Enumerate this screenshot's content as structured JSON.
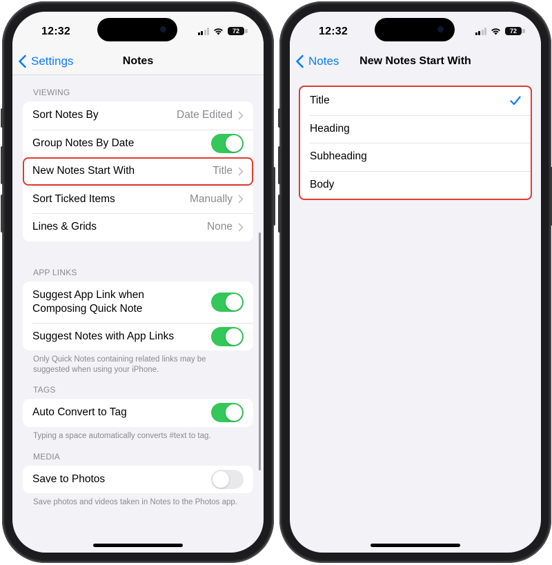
{
  "status_bar": {
    "time": "12:32",
    "battery": "72"
  },
  "left_screen": {
    "nav": {
      "back_label": "Settings",
      "title": "Notes"
    },
    "sections": [
      {
        "header": "VIEWING",
        "rows": [
          {
            "label": "Sort Notes By",
            "value": "Date Edited",
            "type": "disclosure"
          },
          {
            "label": "Group Notes By Date",
            "type": "toggle",
            "on": true
          },
          {
            "label": "New Notes Start With",
            "value": "Title",
            "type": "disclosure",
            "highlighted": true
          },
          {
            "label": "Sort Ticked Items",
            "value": "Manually",
            "type": "disclosure"
          },
          {
            "label": "Lines & Grids",
            "value": "None",
            "type": "disclosure"
          }
        ]
      },
      {
        "header": "APP LINKS",
        "rows": [
          {
            "label": "Suggest App Link when Composing Quick Note",
            "type": "toggle",
            "on": true
          },
          {
            "label": "Suggest Notes with App Links",
            "type": "toggle",
            "on": true
          }
        ],
        "footer": "Only Quick Notes containing related links may be suggested when using your iPhone."
      },
      {
        "header": "TAGS",
        "rows": [
          {
            "label": "Auto Convert to Tag",
            "type": "toggle",
            "on": true
          }
        ],
        "footer": "Typing a space automatically converts #text to tag."
      },
      {
        "header": "MEDIA",
        "rows": [
          {
            "label": "Save to Photos",
            "type": "toggle",
            "on": false
          }
        ],
        "footer": "Save photos and videos taken in Notes to the Photos app."
      }
    ]
  },
  "right_screen": {
    "nav": {
      "back_label": "Notes",
      "title": "New Notes Start With"
    },
    "options": [
      {
        "label": "Title",
        "selected": true
      },
      {
        "label": "Heading",
        "selected": false
      },
      {
        "label": "Subheading",
        "selected": false
      },
      {
        "label": "Body",
        "selected": false
      }
    ]
  },
  "colors": {
    "accent": "#0a7aff",
    "toggle_on": "#34c759",
    "toggle_off": "#e9e9eb",
    "highlight": "#e23b2e",
    "background": "#f2f2f7"
  }
}
